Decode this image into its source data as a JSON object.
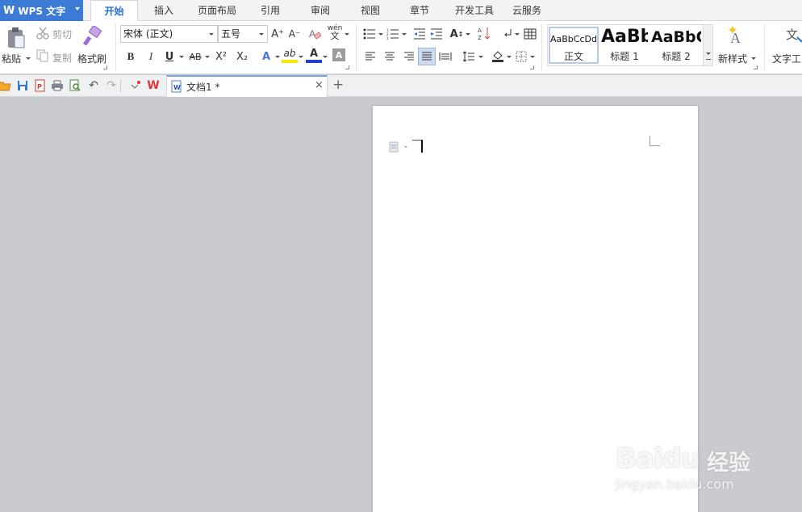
{
  "app": {
    "name": "WPS 文字",
    "colors": {
      "accent": "#3d7ad6",
      "active_tab_text": "#2a6fd0",
      "workspace_bg": "#c9cbd1"
    }
  },
  "ribbon_tabs": [
    {
      "label": "开始",
      "active": true
    },
    {
      "label": "插入",
      "active": false
    },
    {
      "label": "页面布局",
      "active": false
    },
    {
      "label": "引用",
      "active": false
    },
    {
      "label": "审阅",
      "active": false
    },
    {
      "label": "视图",
      "active": false
    },
    {
      "label": "章节",
      "active": false
    },
    {
      "label": "开发工具",
      "active": false
    },
    {
      "label": "云服务",
      "active": false
    }
  ],
  "clipboard": {
    "paste": "粘贴",
    "cut": "剪切",
    "copy": "复制",
    "format_painter": "格式刷"
  },
  "font": {
    "name": "宋体 (正文)",
    "size": "五号",
    "bold": "B",
    "italic": "I",
    "underline": "U",
    "strikethrough": "AB",
    "superscript": "X²",
    "subscript": "X₂",
    "text_effect": "A",
    "highlight": "ab",
    "font_color": "A",
    "char_shading": "A",
    "grow": "A⁺",
    "shrink": "A⁻",
    "pinyin": "wén"
  },
  "styles": {
    "items": [
      {
        "preview": "AaBbCcDd",
        "name": "正文"
      },
      {
        "preview": "AaBb",
        "name": "标题 1"
      },
      {
        "preview": "AaBbC",
        "name": "标题 2"
      }
    ],
    "new_style": "新样式",
    "text_tools": "文字工"
  },
  "document_tab": {
    "title": "文档1 *"
  },
  "icons": [
    "folder-open-icon",
    "save-icon",
    "export-pdf-icon",
    "print-icon",
    "print-preview-icon",
    "undo-icon",
    "redo-icon",
    "customize-icon",
    "wps-logo-icon",
    "close-icon",
    "add-tab-icon"
  ],
  "watermark": {
    "brand": "Baidu",
    "product": "经验",
    "url": "jingyan.baidu.com"
  }
}
